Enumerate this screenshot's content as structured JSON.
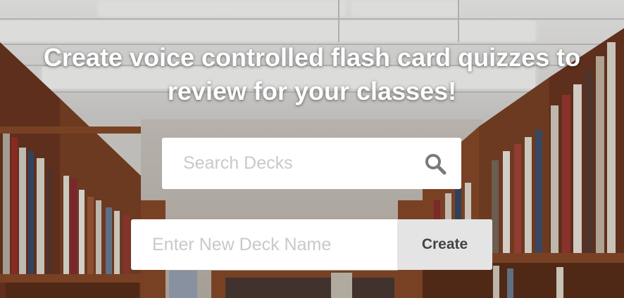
{
  "hero": {
    "headline_line1": "Create voice controlled flash card quizzes to",
    "headline_line2": "review for your classes!"
  },
  "search": {
    "placeholder": "Search Decks",
    "icon": "search-icon"
  },
  "new_deck": {
    "placeholder": "Enter New Deck Name",
    "button_label": "Create"
  },
  "colors": {
    "headline": "#ffffff",
    "input_background": "#ffffff",
    "placeholder": "#c9c9c9",
    "create_button_background": "#e4e4e4",
    "create_button_text": "#444444",
    "icon": "#7a7a7a"
  }
}
